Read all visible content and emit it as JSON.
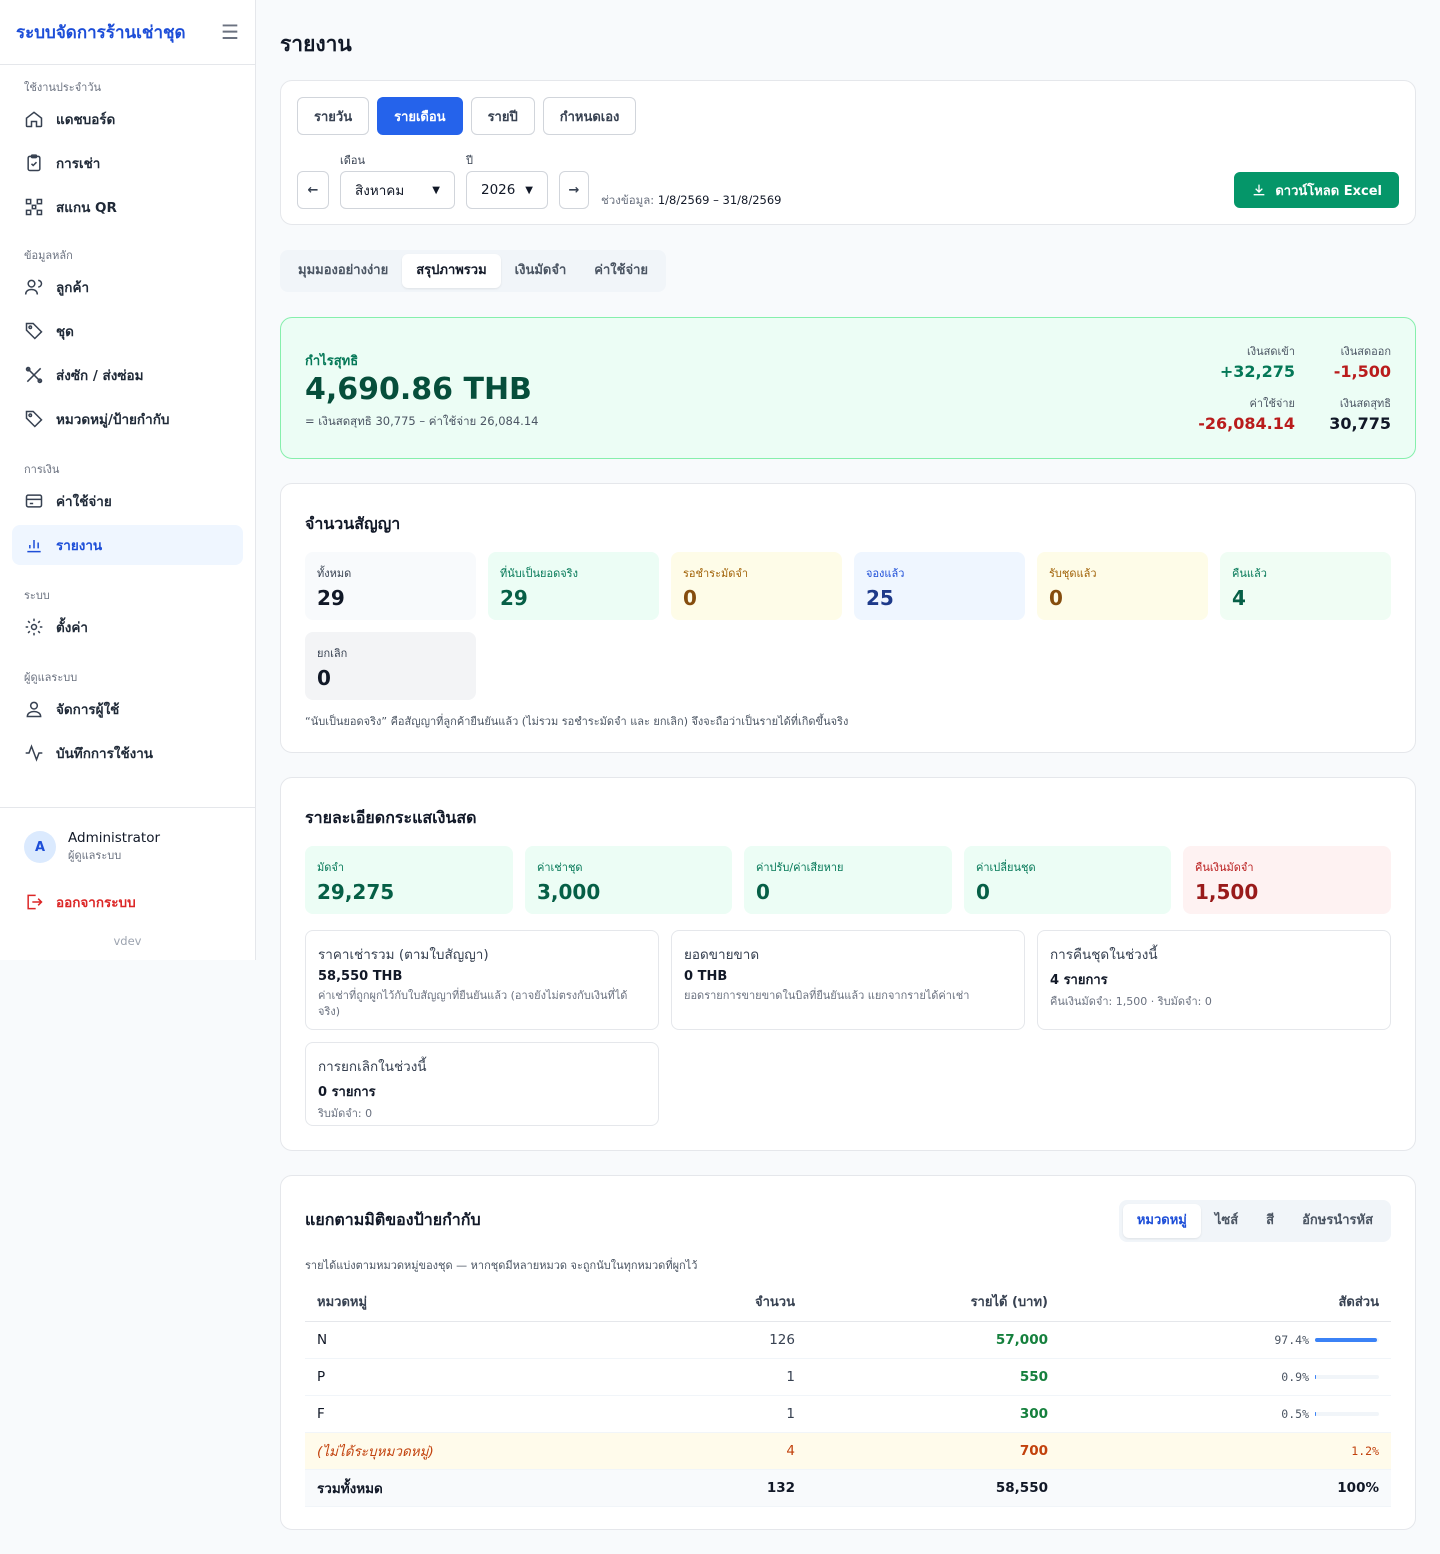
{
  "sidebar": {
    "brand": "ระบบจัดการร้านเช่าชุด",
    "sections": [
      {
        "label": "ใช้งานประจำวัน",
        "items": [
          {
            "label": "แดชบอร์ด",
            "icon": "home-icon"
          },
          {
            "label": "การเช่า",
            "icon": "clipboard-icon"
          },
          {
            "label": "สแกน QR",
            "icon": "qr-icon"
          }
        ]
      },
      {
        "label": "ข้อมูลหลัก",
        "items": [
          {
            "label": "ลูกค้า",
            "icon": "users-icon"
          },
          {
            "label": "ชุด",
            "icon": "tag-icon"
          },
          {
            "label": "ส่งซัก / ส่งซ่อม",
            "icon": "tools-icon"
          },
          {
            "label": "หมวดหมู่/ป้ายกำกับ",
            "icon": "tag-icon"
          }
        ]
      },
      {
        "label": "การเงิน",
        "items": [
          {
            "label": "ค่าใช้จ่าย",
            "icon": "card-icon"
          },
          {
            "label": "รายงาน",
            "icon": "chart-icon",
            "active": true
          }
        ]
      },
      {
        "label": "ระบบ",
        "items": [
          {
            "label": "ตั้งค่า",
            "icon": "gear-icon"
          }
        ]
      },
      {
        "label": "ผู้ดูแลระบบ",
        "items": [
          {
            "label": "จัดการผู้ใช้",
            "icon": "user-icon"
          },
          {
            "label": "บันทึกการใช้งาน",
            "icon": "activity-icon"
          }
        ]
      }
    ],
    "user": {
      "initial": "A",
      "name": "Administrator",
      "role": "ผู้ดูแลระบบ"
    },
    "logout": "ออกจากระบบ",
    "version": "vdev"
  },
  "page": {
    "title": "รายงาน",
    "periods": [
      "รายวัน",
      "รายเดือน",
      "รายปี",
      "กำหนดเอง"
    ],
    "active_period": 1,
    "month_label": "เดือน",
    "month_value": "สิงหาคม",
    "year_label": "ปี",
    "year_value": "2026",
    "range_label": "ช่วงข้อมูล:",
    "range_value": "1/8/2569 – 31/8/2569",
    "download": "ดาวน์โหลด Excel",
    "tabs": [
      "มุมมองอย่างง่าย",
      "สรุปภาพรวม",
      "เงินมัดจำ",
      "ค่าใช้จ่าย"
    ],
    "active_tab": 1
  },
  "profit": {
    "label": "กำไรสุทธิ",
    "value": "4,690.86 THB",
    "formula": "= เงินสดสุทธิ 30,775 – ค่าใช้จ่าย 26,084.14",
    "cash_in_label": "เงินสดเข้า",
    "cash_in": "+32,275",
    "cash_out_label": "เงินสดออก",
    "cash_out": "-1,500",
    "expense_label": "ค่าใช้จ่าย",
    "expense": "-26,084.14",
    "net_cash_label": "เงินสดสุทธิ",
    "net_cash": "30,775"
  },
  "contracts": {
    "title": "จำนวนสัญญา",
    "stats": [
      {
        "label": "ทั้งหมด",
        "value": "29"
      },
      {
        "label": "ที่นับเป็นยอดจริง",
        "value": "29"
      },
      {
        "label": "รอชำระมัดจำ",
        "value": "0"
      },
      {
        "label": "จองแล้ว",
        "value": "25"
      },
      {
        "label": "รับชุดแล้ว",
        "value": "0"
      },
      {
        "label": "คืนแล้ว",
        "value": "4"
      },
      {
        "label": "ยกเลิก",
        "value": "0"
      }
    ],
    "note": "“นับเป็นยอดจริง” คือสัญญาที่ลูกค้ายืนยันแล้ว (ไม่รวม รอชำระมัดจำ และ ยกเลิก) จึงจะถือว่าเป็นรายได้ที่เกิดขึ้นจริง"
  },
  "cashflow": {
    "title": "รายละเอียดกระแสเงินสด",
    "stats": [
      {
        "label": "มัดจำ",
        "value": "29,275"
      },
      {
        "label": "ค่าเช่าชุด",
        "value": "3,000"
      },
      {
        "label": "ค่าปรับ/ค่าเสียหาย",
        "value": "0"
      },
      {
        "label": "ค่าเปลี่ยนชุด",
        "value": "0"
      },
      {
        "label": "คืนเงินมัดจำ",
        "value": "1,500"
      }
    ],
    "info": [
      {
        "title": "ราคาเช่ารวม (ตามใบสัญญา)",
        "value": "58,550 THB",
        "desc": "ค่าเช่าที่ถูกผูกไว้กับใบสัญญาที่ยืนยันแล้ว (อาจยังไม่ตรงกับเงินที่ได้จริง)"
      },
      {
        "title": "ยอดขายขาด",
        "value": "0 THB",
        "desc": "ยอดรายการขายขาดในบิลที่ยืนยันแล้ว แยกจากรายได้ค่าเช่า"
      },
      {
        "title": "การคืนชุดในช่วงนี้",
        "value": "4 รายการ",
        "desc": "คืนเงินมัดจำ: 1,500 · ริบมัดจำ: 0"
      },
      {
        "title": "การยกเลิกในช่วงนี้",
        "value": "0 รายการ",
        "desc": "ริบมัดจำ: 0"
      }
    ]
  },
  "dimension": {
    "title": "แยกตามมิติของป้ายกำกับ",
    "tabs": [
      "หมวดหมู่",
      "ไซส์",
      "สี",
      "อักษรนำรหัส"
    ],
    "active_tab": 0,
    "note": "รายได้แบ่งตามหมวดหมู่ของชุด — หากชุดมีหลายหมวด จะถูกนับในทุกหมวดที่ผูกไว้",
    "columns": [
      "หมวดหมู่",
      "จำนวน",
      "รายได้ (บาท)",
      "สัดส่วน"
    ],
    "rows": [
      {
        "name": "N",
        "count": "126",
        "revenue": "57,000",
        "share": "97.4%",
        "share_value": 97.4
      },
      {
        "name": "P",
        "count": "1",
        "revenue": "550",
        "share": "0.9%",
        "share_value": 0.9
      },
      {
        "name": "F",
        "count": "1",
        "revenue": "300",
        "share": "0.5%",
        "share_value": 0.5
      }
    ],
    "unassigned": {
      "name": "(ไม่ได้ระบุหมวดหมู่)",
      "count": "4",
      "revenue": "700",
      "share": "1.2%"
    },
    "total": {
      "name": "รวมทั้งหมด",
      "count": "132",
      "revenue": "58,550",
      "share": "100%"
    },
    "colors": {
      "bar": "#3b82f6",
      "revenue": "#15803d",
      "unassigned": "#c2410c"
    }
  }
}
